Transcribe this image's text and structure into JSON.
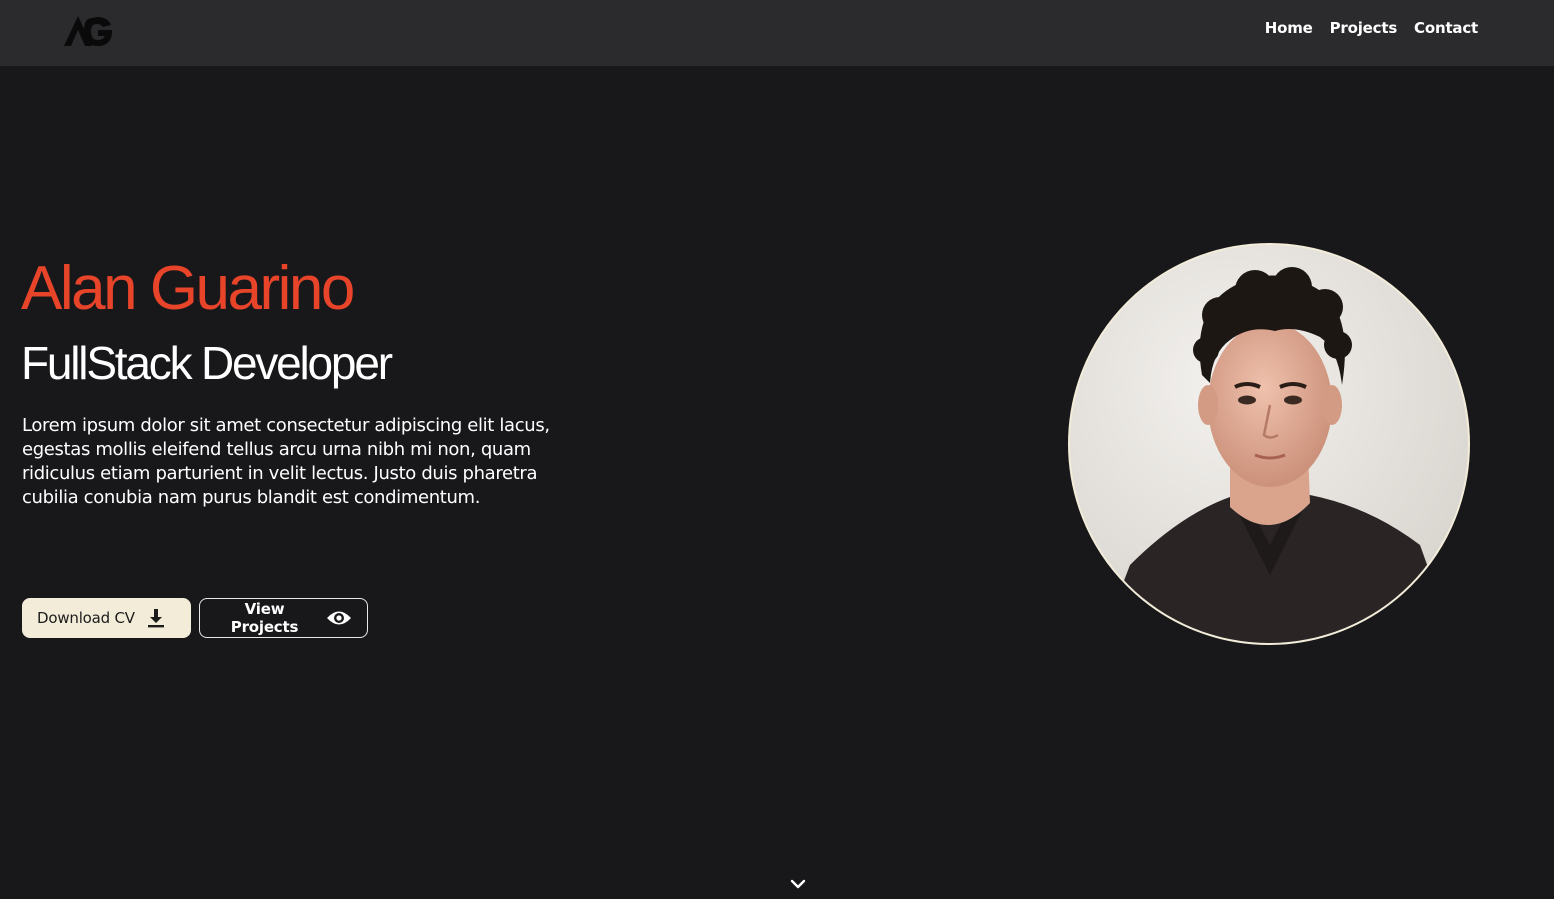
{
  "header": {
    "logo_text": "AG",
    "nav": [
      {
        "label": "Home"
      },
      {
        "label": "Projects"
      },
      {
        "label": "Contact"
      }
    ]
  },
  "hero": {
    "name": "Alan Guarino",
    "role": "FullStack Developer",
    "description": "Lorem ipsum dolor sit amet consectetur adipiscing elit lacus, egestas mollis eleifend tellus arcu urna nibh mi non, quam ridiculus etiam parturient in velit lectus. Justo duis pharetra cubilia conubia nam purus blandit est condimentum.",
    "buttons": {
      "download_cv": {
        "label": "Download CV",
        "icon": "download-icon"
      },
      "view_projects": {
        "label": "View Projects",
        "icon": "eye-icon"
      }
    }
  },
  "profile_photo": {
    "alt": "Alan Guarino portrait"
  },
  "scroll_indicator": {
    "icon": "chevron-down-icon"
  },
  "colors": {
    "background": "#18181b",
    "navbar": "#2b2b2e",
    "accent": "#e8442a",
    "cream": "#f2ecd9"
  }
}
